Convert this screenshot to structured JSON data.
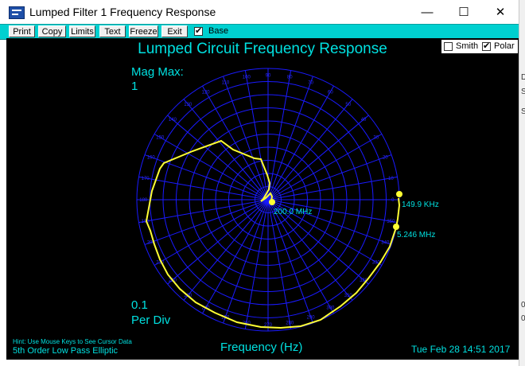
{
  "window": {
    "title": "Lumped Filter 1 Frequency Response",
    "minimize_glyph": "—",
    "maximize_glyph": "☐",
    "close_glyph": "✕"
  },
  "toolbar": {
    "buttons": [
      "Print",
      "Copy",
      "Limits",
      "Text",
      "Freeze",
      "Exit"
    ],
    "base_label": "Base",
    "base_checked": true
  },
  "plot": {
    "title": "Lumped Circuit Frequency Response",
    "mag_max_label": "Mag Max:",
    "mag_max_value": "1",
    "per_div_value": "0.1",
    "per_div_label": "Per Div",
    "hint": "Hint: Use Mouse Keys to See Cursor Data",
    "filter_desc": "5th Order Low Pass Elliptic",
    "x_label": "Frequency (Hz)",
    "timestamp": "Tue Feb 28 14:51 2017",
    "smith_label": "Smith",
    "smith_checked": false,
    "polar_label": "Polar",
    "polar_checked": true,
    "markers": [
      {
        "label": "149.9 KHz"
      },
      {
        "label": "5.246 MHz"
      },
      {
        "label": "200.0 MHz"
      }
    ]
  },
  "colors": {
    "grid": "#1a1aff",
    "trace": "#ffff33",
    "text": "#00e0e0",
    "background": "#000000",
    "toolbar": "#00d0d0"
  },
  "edge_fragments": [
    "D",
    "S",
    "S",
    "0.",
    "0"
  ]
}
